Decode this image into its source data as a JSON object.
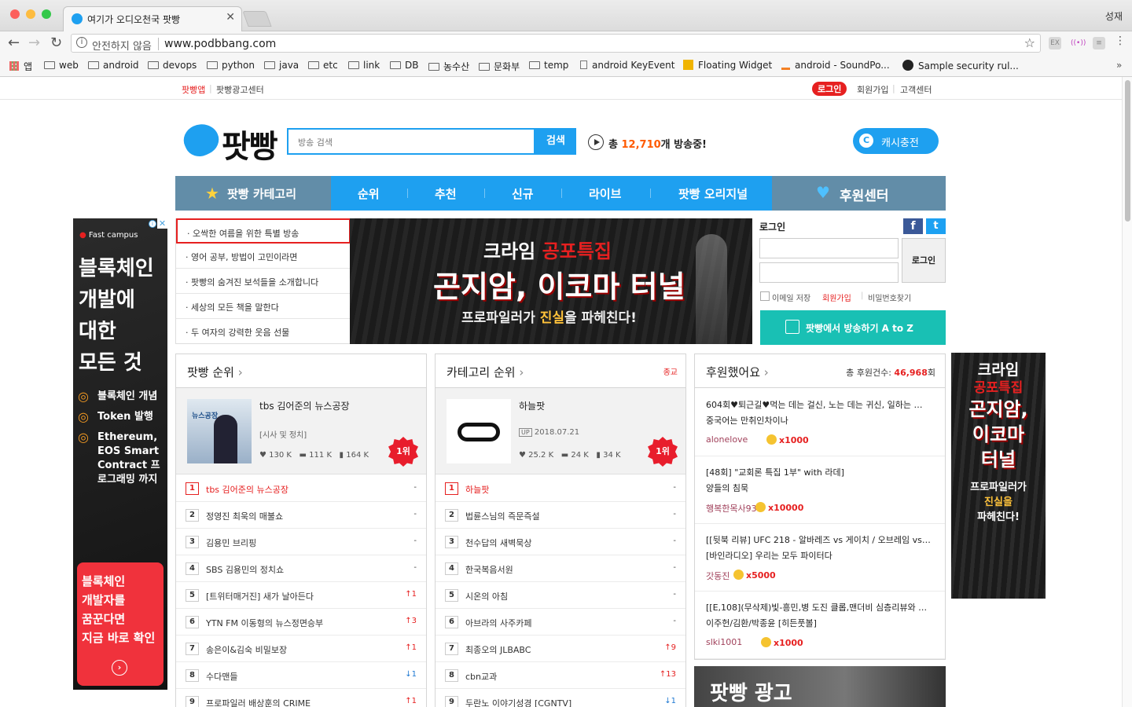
{
  "browser": {
    "tab_title": "여기가 오디오천국 팟빵",
    "profile": "성재",
    "security": "안전하지 않음",
    "url": "www.podbbang.com",
    "bookmarks": [
      "앱",
      "web",
      "android",
      "devops",
      "python",
      "java",
      "etc",
      "link",
      "DB",
      "농수산",
      "문화부",
      "temp",
      "android KeyEvent",
      "Floating Widget",
      "android - SoundPo...",
      "Sample security rul..."
    ]
  },
  "top": {
    "left_links": [
      "팟빵앱",
      "팟빵광고센터"
    ],
    "login": "로그인",
    "signup": "회원가입",
    "support": "고객센터"
  },
  "header": {
    "logo": "팟빵",
    "search_placeholder": "방송 검색",
    "search_button": "검색",
    "onair_prefix": "총 ",
    "onair_count": "12,710",
    "onair_suffix": "개 방송중!",
    "cash_button": "캐시충전"
  },
  "nav": {
    "category": "팟빵 카테고리",
    "items": [
      "순위",
      "추천",
      "신규",
      "라이브",
      "팟빵 오리지널"
    ],
    "support": "후원센터"
  },
  "left_ad": {
    "brand": "Fast campus",
    "headline": [
      "블록체인",
      "개발에",
      "대한",
      "모든 것"
    ],
    "bullets": [
      "블록체인 개념",
      "Token 발행",
      "Ethereum, EOS Smart Contract 프로그래밍 까지"
    ],
    "cta": [
      "블록체인",
      "개발자를",
      "꿈꾼다면",
      "지금 바로 확인"
    ]
  },
  "featured": [
    "오싹한 여름을 위한 특별 방송",
    "영어 공부, 방법이 고민이라면",
    "팟빵의 숨겨진 보석들을 소개합니다",
    "세상의 모든 책을 말한다",
    "두 여자의 강력한 웃음 선물"
  ],
  "banner": {
    "tag1": "크라임 ",
    "tag2": "공포특집",
    "title": "곤지암, 이코마 터널",
    "sub1": "프로파일러가 ",
    "sub2": "진실",
    "sub3": "을 파헤친다!"
  },
  "login": {
    "title": "로그인",
    "button": "로그인",
    "remember": "이메일 저장",
    "signup": "회원가입",
    "find_pw": "비밀번호찾기",
    "guide_button": "팟빵에서 방송하기 A to Z"
  },
  "panel_rank": {
    "title": "팟빵 순위",
    "featured": {
      "title": "tbs 김어준의 뉴스공장",
      "sub": "[시사 및 정치]",
      "likes": "130 K",
      "comments": "111 K",
      "bookmarks": "164 K",
      "badge": "1위"
    },
    "rows": [
      {
        "rank": "1",
        "name": "tbs 김어준의 뉴스공장",
        "change": "-"
      },
      {
        "rank": "2",
        "name": "정영진 최욱의 매불쇼",
        "change": "-"
      },
      {
        "rank": "3",
        "name": "김용민 브리핑",
        "change": "-"
      },
      {
        "rank": "4",
        "name": "SBS 김용민의 정치쇼",
        "change": "-"
      },
      {
        "rank": "5",
        "name": "[트위터매거진] 새가 날아든다",
        "change": "↑1"
      },
      {
        "rank": "6",
        "name": "YTN FM 이동형의 뉴스정면승부",
        "change": "↑3"
      },
      {
        "rank": "7",
        "name": "송은이&김숙 비밀보장",
        "change": "↑1"
      },
      {
        "rank": "8",
        "name": "수다맨들",
        "change": "↓1"
      },
      {
        "rank": "9",
        "name": "프로파일러 배상훈의 CRIME",
        "change": "↑1"
      }
    ]
  },
  "panel_category": {
    "title": "카테고리 순위",
    "tag": "종교",
    "featured": {
      "title": "하늘팟",
      "up": "UP",
      "date": "2018.07.21",
      "likes": "25.2 K",
      "comments": "24 K",
      "bookmarks": "34 K",
      "badge": "1위"
    },
    "rows": [
      {
        "rank": "1",
        "name": "하늘팟",
        "change": "-"
      },
      {
        "rank": "2",
        "name": "법륜스님의 즉문즉설",
        "change": "-"
      },
      {
        "rank": "3",
        "name": "천수답의 새벽묵상",
        "change": "-"
      },
      {
        "rank": "4",
        "name": "한국복음서원",
        "change": "-"
      },
      {
        "rank": "5",
        "name": "시온의 아침",
        "change": "-"
      },
      {
        "rank": "6",
        "name": "아브라의 사주카페",
        "change": "-"
      },
      {
        "rank": "7",
        "name": "최종오의 JLBABC",
        "change": "↑9"
      },
      {
        "rank": "8",
        "name": "cbn교과",
        "change": "↑13"
      },
      {
        "rank": "9",
        "name": "두란노 이야기성경 [CGNTV]",
        "change": "↓1"
      }
    ]
  },
  "panel_support": {
    "title": "후원했어요",
    "total_label": "총 후원건수: ",
    "total_value": "46,968",
    "total_unit": "회",
    "rows": [
      {
        "line1": "604회♥퇴근길♥먹는 데는 걸신, 노는 데는 귀신, 일하는 …",
        "line2": "중국어는 만취인차이나",
        "user": "alonelove",
        "amount": "x1000"
      },
      {
        "line1": "[48회] \"교회론 특집 1부\" with 라데]",
        "line2": "양들의 침묵",
        "user": "행복한목사93",
        "amount": "x10000"
      },
      {
        "line1": "[[뒷북 리뷰] UFC 218 - 알바레즈 vs 게이치 / 오브레임 vs…",
        "line2": "[바인라디오] 우리는 모두 파이터다",
        "user": "갓동진",
        "amount": "x5000"
      },
      {
        "line1": "[[E,108](무삭제)빛-흥민,병 도진 클롭,맨더비 심층리뷰와 …",
        "line2": "이주헌/김환/박종윤 [히든풋볼]",
        "user": "slki1001",
        "amount": "x1000"
      }
    ]
  },
  "ad_panel": {
    "title": "팟빵 광고"
  },
  "right_ad": {
    "lines": [
      "크라임",
      "공포특집",
      "곤지암,",
      "이코마",
      "터널"
    ],
    "sub": [
      "프로파일러가",
      "진실을",
      "파헤친다!"
    ]
  }
}
